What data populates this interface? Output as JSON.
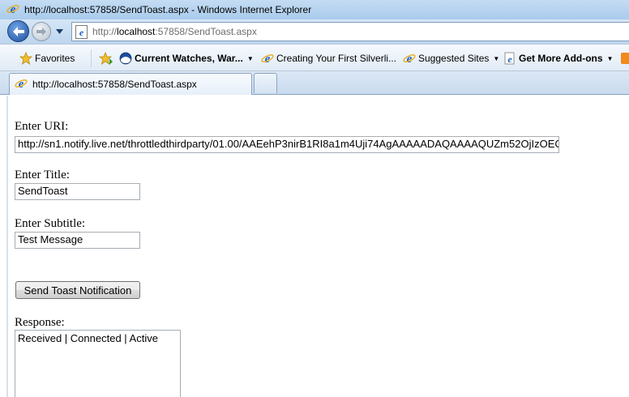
{
  "window": {
    "title": "http://localhost:57858/SendToast.aspx - Windows Internet Explorer"
  },
  "address": {
    "prefix": "http://",
    "host": "localhost",
    "rest": ":57858/SendToast.aspx"
  },
  "favorites_bar": {
    "favorites": "Favorites",
    "items": [
      {
        "label": "Current Watches, War...",
        "icon": "noaa-icon"
      },
      {
        "label": "Creating Your First Silverli...",
        "icon": "ie-icon"
      },
      {
        "label": "Suggested Sites",
        "icon": "ie-icon"
      },
      {
        "label": "Get More Add-ons",
        "icon": "ie-page-icon"
      }
    ]
  },
  "tabs": [
    {
      "label": "http://localhost:57858/SendToast.aspx",
      "active": true
    }
  ],
  "form": {
    "uri_label": "Enter URI:",
    "uri_value": "http://sn1.notify.live.net/throttledthirdparty/01.00/AAEehP3nirB1RI8a1m4Uji74AgAAAAADAQAAAAQUZm52OjIzOEC",
    "title_label": "Enter Title:",
    "title_value": "SendToast",
    "subtitle_label": "Enter Subtitle:",
    "subtitle_value": "Test Message",
    "send_button": "Send Toast Notification",
    "response_label": "Response:",
    "response_value": "Received | Connected | Active"
  },
  "colors": {
    "titlebar": "#b8d4f0",
    "ie_blue": "#1f5fbf",
    "ie_gold": "#e8a912"
  }
}
